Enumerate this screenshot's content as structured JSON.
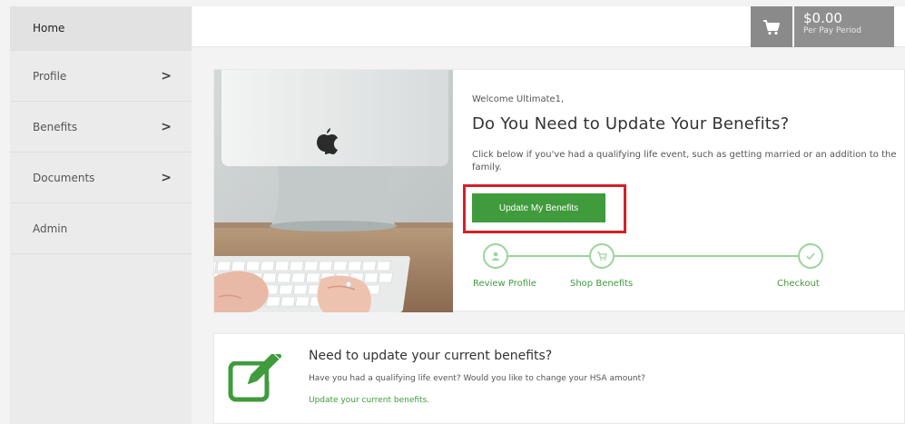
{
  "sidebar": {
    "items": [
      {
        "label": "Home",
        "has_chevron": false
      },
      {
        "label": "Profile",
        "chevron": ">"
      },
      {
        "label": "Benefits",
        "chevron": ">"
      },
      {
        "label": "Documents",
        "chevron": ">"
      },
      {
        "label": "Admin",
        "has_chevron": false
      }
    ]
  },
  "cart": {
    "amount": "$0.00",
    "period": "Per Pay Period",
    "icon": "cart-icon"
  },
  "hero": {
    "welcome": "Welcome Ultimate1,",
    "headline": "Do You Need to Update Your Benefits?",
    "description": "Click below if you've had a qualifying life event, such as getting married or an addition to the family.",
    "button_label": "Update My Benefits",
    "steps": [
      {
        "label": "Review Profile",
        "icon": "user-icon"
      },
      {
        "label": "Shop Benefits",
        "icon": "cart-icon"
      },
      {
        "label": "Checkout",
        "icon": "check-icon"
      }
    ]
  },
  "update_card": {
    "title": "Need to update your current benefits?",
    "description": "Have you had a qualifying life event? Would you like to change your HSA amount?",
    "link_label": "Update your current benefits.",
    "icon": "edit-icon"
  },
  "colors": {
    "accent_green": "#3f9b3b",
    "step_green": "#9bd59b",
    "highlight_red": "#d41f26",
    "cart_gray": "#8f8f8f"
  }
}
